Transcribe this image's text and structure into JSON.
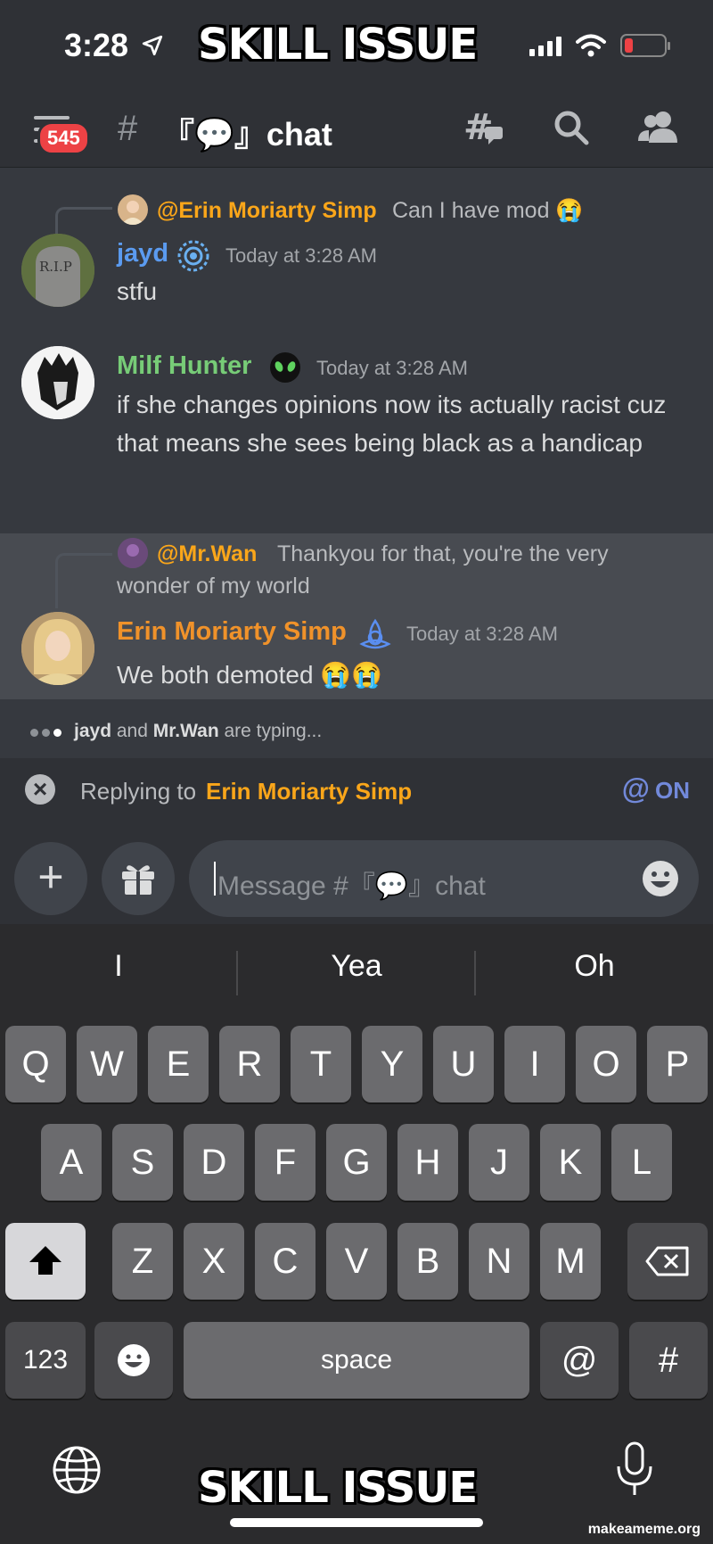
{
  "status": {
    "time": "3:28"
  },
  "meme": {
    "top": "SKILL ISSUE",
    "bottom": "SKILL ISSUE"
  },
  "header": {
    "badge": "545",
    "hash": "#",
    "channel": "『💬』chat"
  },
  "messages": [
    {
      "reply": {
        "author": "@Erin Moriarty Simp",
        "text": "Can I have mod 😭"
      },
      "author": "jayd",
      "author_color": "#5b9bf0",
      "badge_icon": "reactor-icon",
      "time": "Today at 3:28 AM",
      "body": "stfu"
    },
    {
      "author": "Milf Hunter",
      "author_color": "#77cc77",
      "badge_icon": "alien-icon",
      "time": "Today at 3:28 AM",
      "body": "if she changes opinions now its actually racist cuz that means she sees being black as a handicap"
    },
    {
      "reply": {
        "author": "@Mr.Wan",
        "text": "Thankyou for that, you're the very wonder of my world"
      },
      "author": "Erin Moriarty Simp",
      "author_color": "#f0922a",
      "badge_icon": "triquetra-icon",
      "time": "Today at 3:28 AM",
      "body": "We both demoted 😭😭"
    }
  ],
  "typing": {
    "user1": "jayd",
    "and": "and",
    "user2": "Mr.Wan",
    "suffix": "are typing..."
  },
  "reply_bar": {
    "label": "Replying to",
    "name": "Erin Moriarty Simp",
    "mention_symbol": "@",
    "mention_state": "ON"
  },
  "composer": {
    "plus": "+",
    "placeholder": "Message #『💬』chat"
  },
  "keyboard": {
    "suggestions": [
      "I",
      "Yea",
      "Oh"
    ],
    "row1": [
      "Q",
      "W",
      "E",
      "R",
      "T",
      "Y",
      "U",
      "I",
      "O",
      "P"
    ],
    "row2": [
      "A",
      "S",
      "D",
      "F",
      "G",
      "H",
      "J",
      "K",
      "L"
    ],
    "row3": [
      "Z",
      "X",
      "C",
      "V",
      "B",
      "N",
      "M"
    ],
    "numbers": "123",
    "space": "space",
    "at": "@",
    "hash": "#"
  },
  "watermark": "makeameme.org"
}
